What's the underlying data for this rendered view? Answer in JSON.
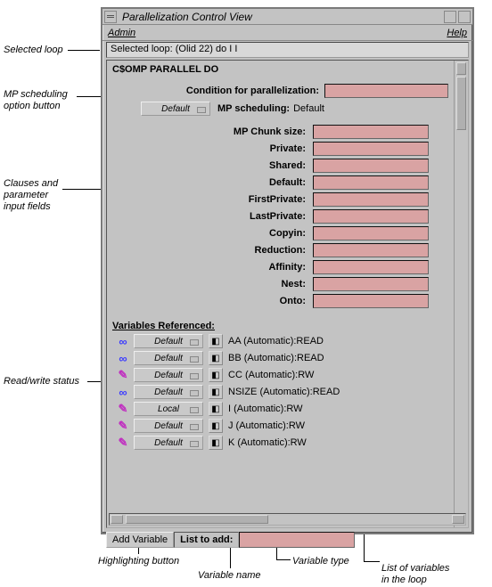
{
  "window": {
    "title": "Parallelization Control View"
  },
  "menubar": {
    "admin": "Admin",
    "help": "Help"
  },
  "selected_loop": "Selected loop: (Olid 22) do I I",
  "pragma": "C$OMP PARALLEL DO",
  "cond_label": "Condition for parallelization:",
  "mp": {
    "button": "Default",
    "label": "MP scheduling:",
    "value": "Default"
  },
  "clauses": [
    {
      "label": "MP Chunk size:"
    },
    {
      "label": "Private:"
    },
    {
      "label": "Shared:"
    },
    {
      "label": "Default:"
    },
    {
      "label": "FirstPrivate:"
    },
    {
      "label": "LastPrivate:"
    },
    {
      "label": "Copyin:"
    },
    {
      "label": "Reduction:"
    },
    {
      "label": "Affinity:"
    },
    {
      "label": "Nest:"
    },
    {
      "label": "Onto:"
    }
  ],
  "vars_header": "Variables Referenced:",
  "vars": [
    {
      "rw": "blue",
      "scope": "Default",
      "name": "AA",
      "type": "(Automatic)",
      "access": "READ"
    },
    {
      "rw": "blue",
      "scope": "Default",
      "name": "BB",
      "type": "(Automatic)",
      "access": "READ"
    },
    {
      "rw": "magenta",
      "scope": "Default",
      "name": "CC",
      "type": "(Automatic)",
      "access": "RW"
    },
    {
      "rw": "blue",
      "scope": "Default",
      "name": "NSIZE",
      "type": "(Automatic)",
      "access": "READ"
    },
    {
      "rw": "magenta",
      "scope": "Local",
      "name": "I",
      "type": "(Automatic)",
      "access": "RW"
    },
    {
      "rw": "magenta",
      "scope": "Default",
      "name": "J",
      "type": "(Automatic)",
      "access": "RW"
    },
    {
      "rw": "magenta",
      "scope": "Default",
      "name": "K",
      "type": "(Automatic)",
      "access": "RW"
    }
  ],
  "footer": {
    "add": "Add Variable",
    "list": "List to add:"
  },
  "annotations": {
    "selected_loop": "Selected loop",
    "mp_button": "MP scheduling\noption button",
    "clauses": "Clauses and\nparameter\ninput fields",
    "rw": "Read/write status",
    "hilite": "Highlighting button",
    "varname": "Variable name",
    "vartype": "Variable type",
    "varlist": "List of variables\nin the loop"
  }
}
